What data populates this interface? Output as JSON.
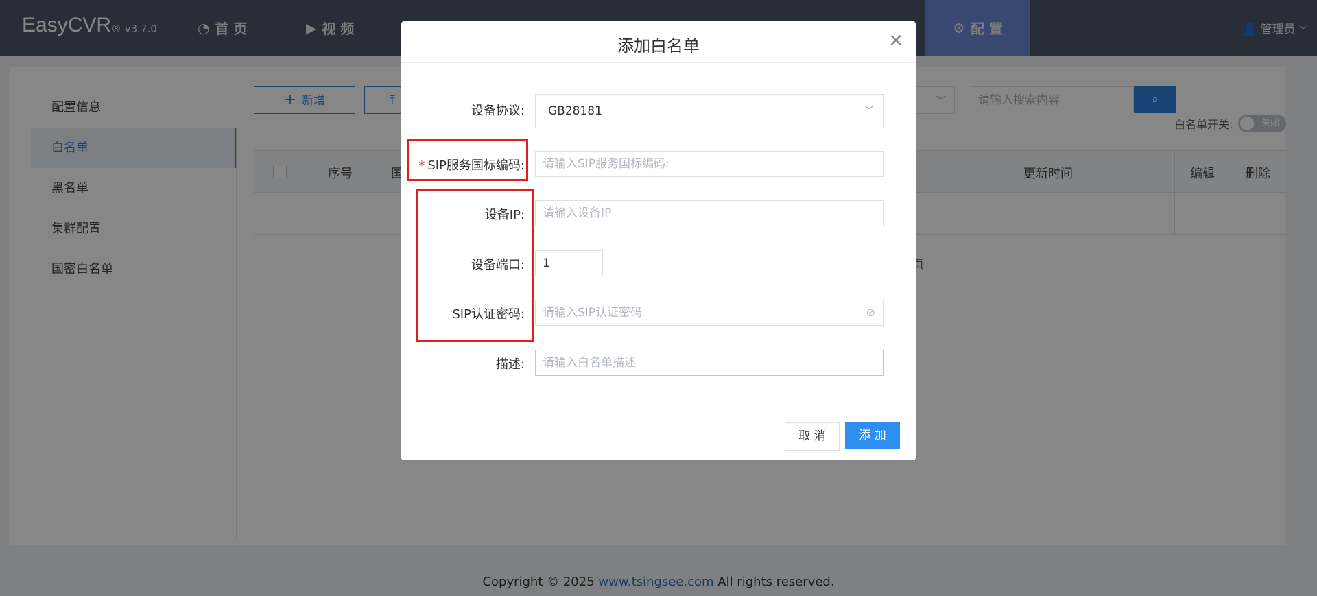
{
  "app": {
    "logo": "EasyCVR",
    "version": "® v3.7.0"
  },
  "nav": {
    "home": "首 页",
    "video": "视 频",
    "config": "配 置",
    "user": "管理员"
  },
  "sidebar": {
    "items": [
      {
        "label": "配置信息"
      },
      {
        "label": "白名单"
      },
      {
        "label": "黑名单"
      },
      {
        "label": "集群配置"
      },
      {
        "label": "国密白名单"
      }
    ]
  },
  "toolbar": {
    "add_label": "新增",
    "search_placeholder": "请输入搜索内容",
    "switch_label": "白名单开关:",
    "switch_state": "关闭"
  },
  "table": {
    "headers": {
      "index": "序号",
      "national": "国",
      "updated": "更新时间",
      "edit": "编辑",
      "delete": "删除"
    },
    "page_fragment": "页"
  },
  "modal": {
    "title": "添加白名单",
    "fields": {
      "protocol": {
        "label": "设备协议:",
        "value": "GB28181"
      },
      "sip_code": {
        "label": "SIP服务国标编码:",
        "placeholder": "请输入SIP服务国标编码:",
        "required": "*"
      },
      "ip": {
        "label": "设备IP:",
        "placeholder": "请输入设备IP"
      },
      "port": {
        "label": "设备端口:",
        "value": "1"
      },
      "sip_password": {
        "label": "SIP认证密码:",
        "placeholder": "请输入SIP认证密码"
      },
      "desc": {
        "label": "描述:",
        "placeholder": "请输入白名单描述"
      }
    },
    "cancel_label": "取 消",
    "submit_label": "添 加"
  },
  "footer": {
    "prefix": "Copyright © 2025 ",
    "link": "www.tsingsee.com",
    "suffix": " All rights reserved."
  },
  "colors": {
    "topbar": "#4a5868",
    "accent": "#2f8ff0",
    "highlight": "#e02020"
  }
}
